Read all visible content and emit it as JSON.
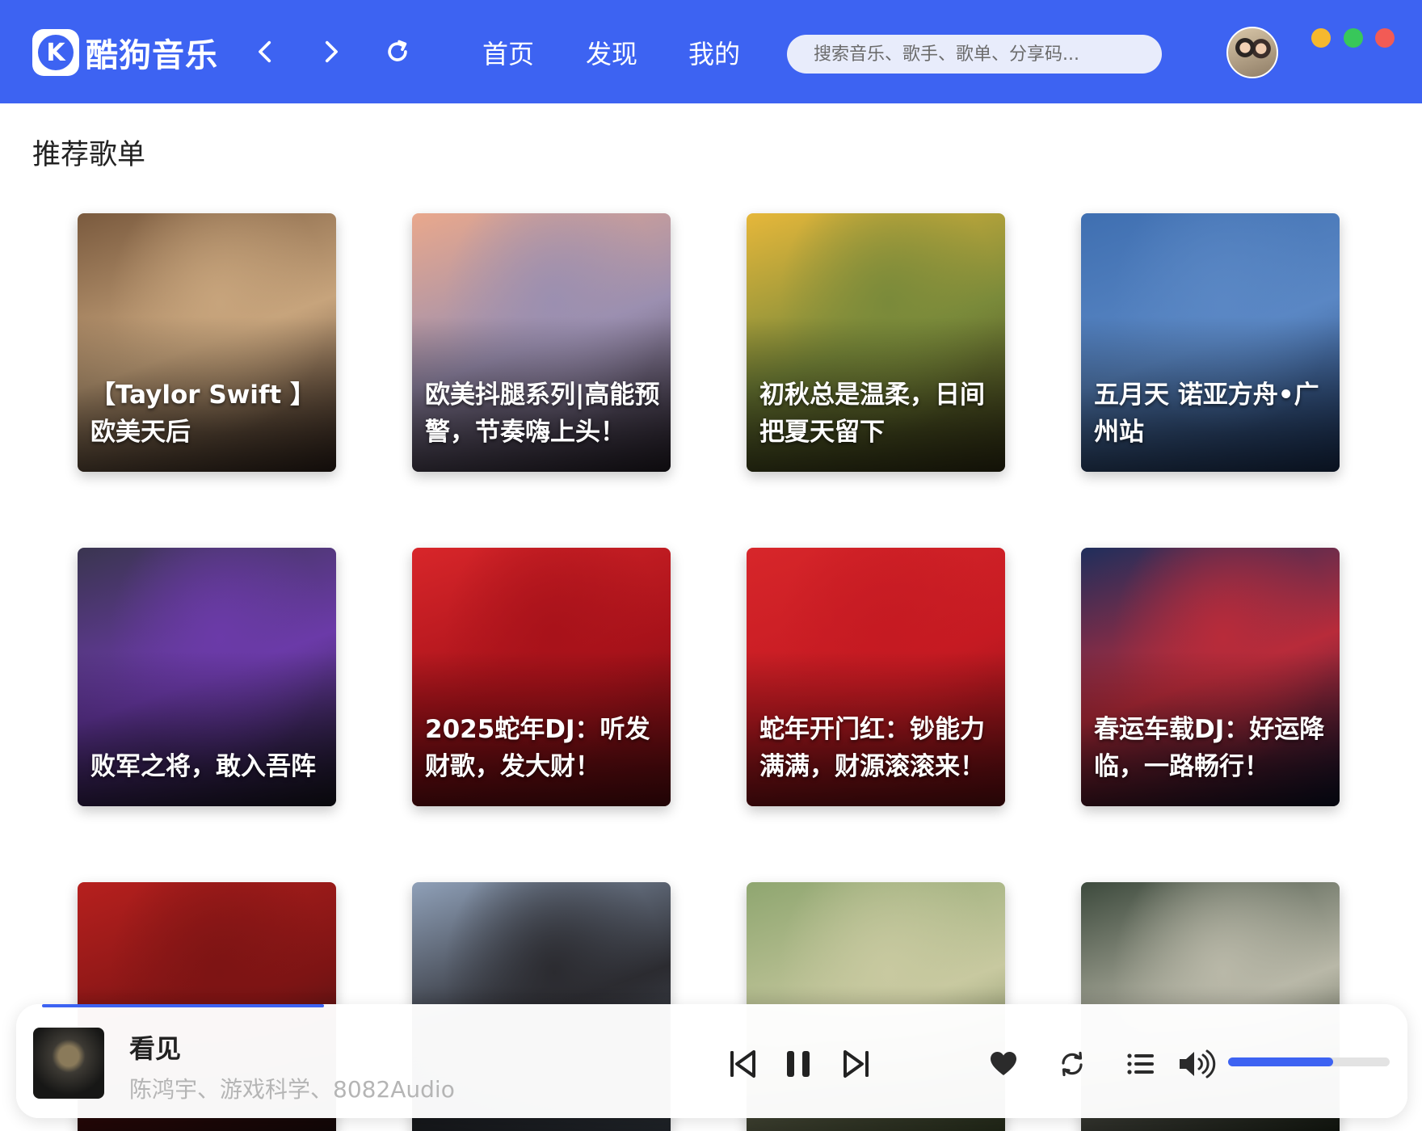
{
  "app": {
    "name": "酷狗音乐",
    "logo_letter": "K"
  },
  "nav": {
    "tabs": [
      {
        "label": "首页"
      },
      {
        "label": "发现"
      },
      {
        "label": "我的"
      }
    ],
    "search_placeholder": "搜索音乐、歌手、歌单、分享码..."
  },
  "section": {
    "title": "推荐歌单"
  },
  "playlists": [
    {
      "title": "【Taylor Swift 】欧美天后",
      "colors": [
        "#7a5a3e",
        "#c7a47c",
        "#3b2a21"
      ]
    },
    {
      "title": "欧美抖腿系列|高能预警，节奏嗨上头！",
      "colors": [
        "#e9a88c",
        "#9b8fb0",
        "#2d2530"
      ]
    },
    {
      "title": "初秋总是温柔，日间把夏天留下",
      "colors": [
        "#e6b73a",
        "#7a8a3a",
        "#3d3a18"
      ]
    },
    {
      "title": "五月天 诺亚方舟•广州站",
      "colors": [
        "#3f6fb1",
        "#5a87c4",
        "#1f3a66"
      ]
    },
    {
      "title": "败军之将，敢入吾阵",
      "colors": [
        "#3a3550",
        "#6b3aa8",
        "#1d1b28"
      ]
    },
    {
      "title": "2025蛇年DJ：听发财歌，发大财！",
      "colors": [
        "#d8262a",
        "#a8121a",
        "#6b0d12"
      ]
    },
    {
      "title": "蛇年开门红：钞能力满满，财源滚滚来！",
      "colors": [
        "#d7262a",
        "#c51a22",
        "#7a1015"
      ]
    },
    {
      "title": "春运车载DJ：好运降临，一路畅行！",
      "colors": [
        "#1f2e5c",
        "#b82b3a",
        "#0e1430"
      ]
    },
    {
      "title": "",
      "colors": [
        "#b6201e",
        "#7d1414",
        "#2a1414"
      ]
    },
    {
      "title": "",
      "colors": [
        "#8fa0b8",
        "#2b2b30",
        "#55606e"
      ]
    },
    {
      "title": "",
      "colors": [
        "#8fa670",
        "#c8c9a0",
        "#4f6038"
      ]
    },
    {
      "title": "",
      "colors": [
        "#3d4a3d",
        "#b9b8a8",
        "#25301f"
      ]
    }
  ],
  "player": {
    "song_title": "看见",
    "artists": "陈鸿宇、游戏科学、8082Audio",
    "progress": 0.21,
    "volume": 0.65,
    "icons": {
      "prev": "skip-previous-icon",
      "pause": "pause-icon",
      "next": "skip-next-icon",
      "like": "heart-icon",
      "loop": "repeat-icon",
      "list": "playlist-icon",
      "volume": "volume-icon"
    }
  },
  "theme": {
    "accent": "#3d63f2",
    "header_bg": "#3d63f2",
    "window_controls": [
      "#f5b82e",
      "#38c75a",
      "#f25b55"
    ]
  }
}
